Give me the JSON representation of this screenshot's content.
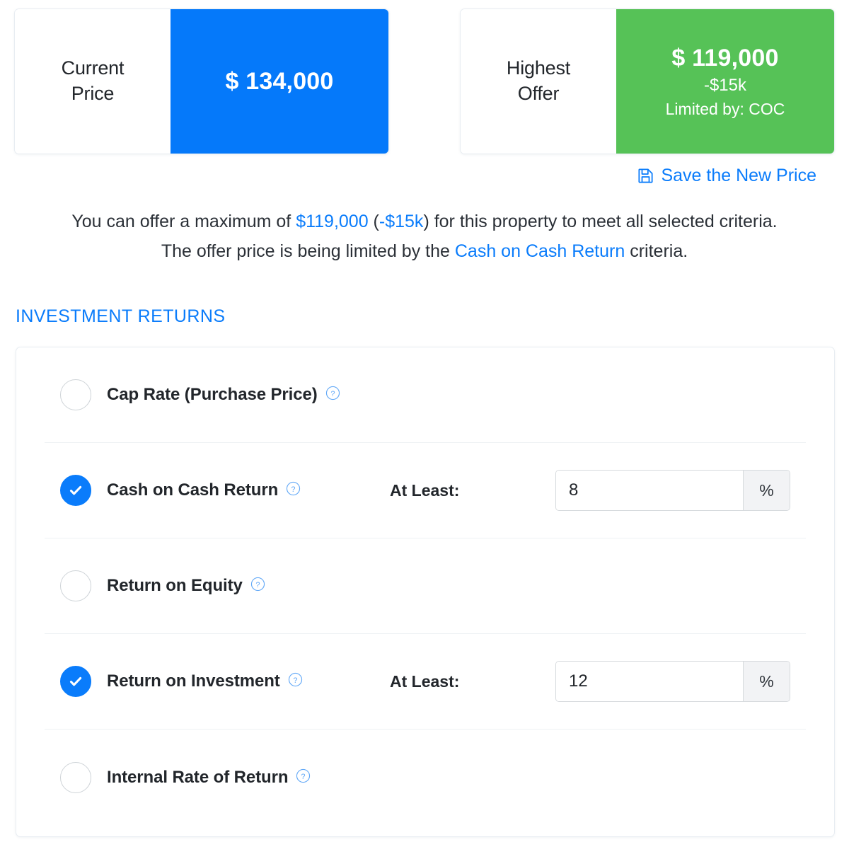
{
  "cards": [
    {
      "name": "current-price",
      "label": "Current\nPrice",
      "label_line1": "Current",
      "label_line2": "Price",
      "value": "$ 134,000",
      "accent": "#0579fa",
      "sub": "",
      "note": ""
    },
    {
      "name": "highest-offer",
      "label_line1": "Highest",
      "label_line2": "Offer",
      "value": "$ 119,000",
      "accent": "#56c257",
      "sub": "-$15k",
      "note": "Limited by: COC"
    }
  ],
  "save": {
    "label": "Save the New Price",
    "icon": "floppy-disk-icon",
    "color": "#0a7cfb"
  },
  "explanation": {
    "line1_part1": "You can offer a maximum of ",
    "line1_amount": "$119,000",
    "line1_part2": " (",
    "line1_delta": "-$15k",
    "line1_part3": ") for this property to meet all selected criteria.",
    "line2_part1": "The offer price is being limited by the ",
    "line2_link": "Cash on Cash Return",
    "line2_part2": " criteria."
  },
  "section": {
    "title": "INVESTMENT RETURNS",
    "color": "#0a7cfb"
  },
  "criteria": [
    {
      "id": "cap-rate",
      "label": "Cap Rate (Purchase Price)",
      "checked": false,
      "help": "?",
      "at_least_label": "",
      "value": "",
      "suffix": ""
    },
    {
      "id": "cash-on-cash-return",
      "label": "Cash on Cash Return",
      "checked": true,
      "help": "?",
      "at_least_label": "At Least:",
      "value": "8",
      "suffix": "%"
    },
    {
      "id": "return-on-equity",
      "label": "Return on Equity",
      "checked": false,
      "help": "?",
      "at_least_label": "",
      "value": "",
      "suffix": ""
    },
    {
      "id": "return-on-investment",
      "label": "Return on Investment",
      "checked": true,
      "help": "?",
      "at_least_label": "At Least:",
      "value": "12",
      "suffix": "%"
    },
    {
      "id": "internal-rate-of-return",
      "label": "Internal Rate of Return",
      "checked": false,
      "help": "?",
      "at_least_label": "",
      "value": "",
      "suffix": ""
    }
  ]
}
